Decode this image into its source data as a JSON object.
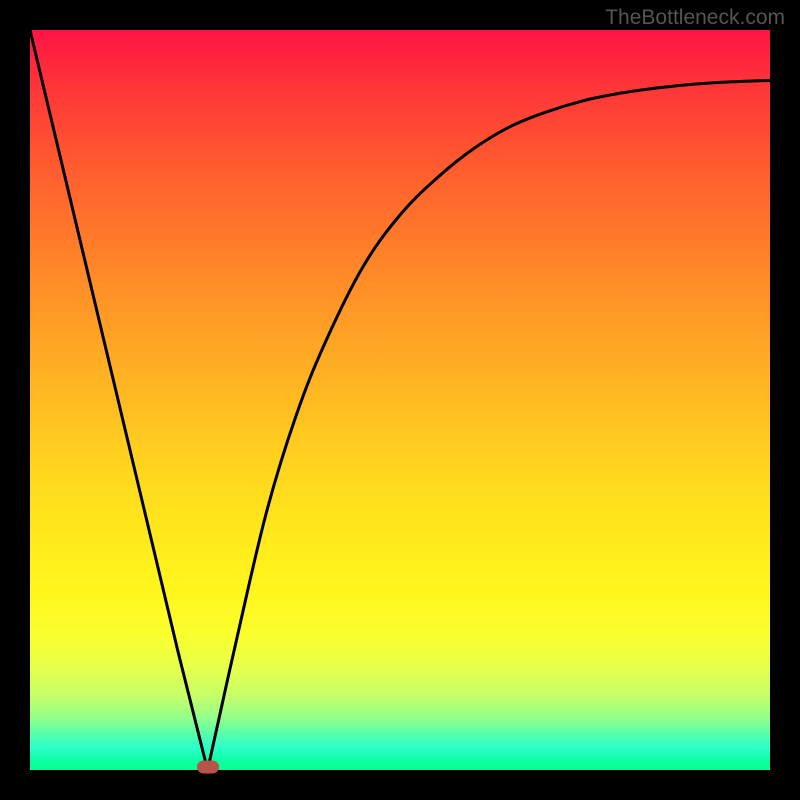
{
  "watermark": "TheBottleneck.com",
  "chart_data": {
    "type": "line",
    "title": "",
    "xlabel": "",
    "ylabel": "",
    "xlim": [
      0,
      100
    ],
    "ylim": [
      0,
      100
    ],
    "series": [
      {
        "name": "bottleneck-curve",
        "x": [
          0,
          5,
          10,
          15,
          20,
          24,
          28,
          32,
          36,
          40,
          45,
          50,
          55,
          60,
          65,
          70,
          75,
          80,
          85,
          90,
          95,
          100
        ],
        "values": [
          100,
          79,
          58,
          37,
          16,
          0,
          18,
          35,
          48,
          58,
          68,
          75,
          80,
          84,
          87,
          89,
          90.5,
          91.5,
          92.2,
          92.7,
          93.0,
          93.2
        ]
      }
    ],
    "marker": {
      "x": 24,
      "y": 0
    },
    "gradient_colors": {
      "top": "#ff1544",
      "bottom": "#0aff8f"
    }
  }
}
